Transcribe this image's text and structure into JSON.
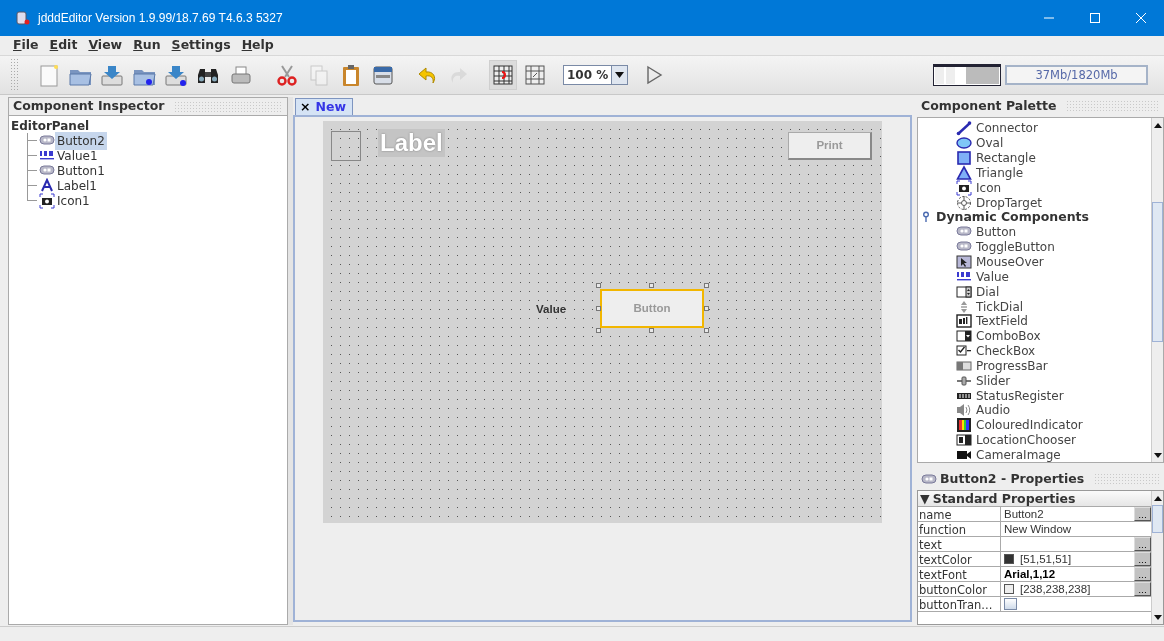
{
  "window": {
    "title": "jdddEditor Version 1.9.99/18.7.69 T4.6.3 5327"
  },
  "menu": [
    {
      "label": "File"
    },
    {
      "label": "Edit"
    },
    {
      "label": "View"
    },
    {
      "label": "Run"
    },
    {
      "label": "Settings"
    },
    {
      "label": "Help"
    }
  ],
  "toolbar": [
    {
      "kind": "new",
      "disabled": false,
      "selected": false
    },
    {
      "kind": "open",
      "disabled": false,
      "selected": false
    },
    {
      "kind": "import",
      "disabled": false,
      "selected": false
    },
    {
      "kind": "open-dot",
      "disabled": false,
      "selected": false
    },
    {
      "kind": "import-dot",
      "disabled": false,
      "selected": false
    },
    {
      "kind": "find",
      "disabled": false,
      "selected": false
    },
    {
      "kind": "print",
      "disabled": false,
      "selected": false
    },
    {
      "kind": "cut",
      "disabled": false,
      "selected": false
    },
    {
      "kind": "copy",
      "disabled": true,
      "selected": false
    },
    {
      "kind": "paste",
      "disabled": false,
      "selected": false
    },
    {
      "kind": "device",
      "disabled": false,
      "selected": false
    },
    {
      "kind": "undo",
      "disabled": false,
      "selected": false
    },
    {
      "kind": "redo",
      "disabled": true,
      "selected": false
    },
    {
      "kind": "grid",
      "disabled": false,
      "selected": true
    },
    {
      "kind": "snap",
      "disabled": false,
      "selected": false
    },
    {
      "kind": "zoom",
      "value": "100 %"
    },
    {
      "kind": "run",
      "disabled": false,
      "selected": false
    }
  ],
  "memory": "37Mb/1820Mb",
  "inspector": {
    "title": "Component Inspector",
    "tree": [
      {
        "label": "EditorPanel",
        "children": [
          {
            "label": "Button2",
            "kind": "button",
            "selected": true
          },
          {
            "label": "Value1",
            "kind": "value",
            "selected": false
          },
          {
            "label": "Button1",
            "kind": "button",
            "selected": false
          },
          {
            "label": "Label1",
            "kind": "label",
            "selected": false
          },
          {
            "label": "Icon1",
            "kind": "icon",
            "selected": false
          }
        ]
      }
    ]
  },
  "editor": {
    "tabs": [
      {
        "label": "New",
        "close": "×",
        "selected": true
      }
    ],
    "components": [
      {
        "kind": "icon"
      },
      {
        "kind": "label",
        "text": "Label"
      },
      {
        "kind": "button",
        "text": "Print",
        "selected": false
      },
      {
        "kind": "value",
        "text": "Value"
      },
      {
        "kind": "button",
        "text": "Button",
        "selected": true
      }
    ]
  },
  "palette": {
    "title": "Component Palette",
    "items": [
      {
        "label": "Connector",
        "kind": "connector"
      },
      {
        "label": "Oval",
        "kind": "oval"
      },
      {
        "label": "Rectangle",
        "kind": "rectangle"
      },
      {
        "label": "Triangle",
        "kind": "triangle"
      },
      {
        "label": "Icon",
        "kind": "icon"
      },
      {
        "label": "DropTarget",
        "kind": "droptarget"
      },
      {
        "label": "Dynamic Components",
        "kind": "group",
        "expanded": true,
        "children": [
          {
            "label": "Button",
            "kind": "button"
          },
          {
            "label": "ToggleButton",
            "kind": "button"
          },
          {
            "label": "MouseOver",
            "kind": "mouseover"
          },
          {
            "label": "Value",
            "kind": "value"
          },
          {
            "label": "Dial",
            "kind": "dial"
          },
          {
            "label": "TickDial",
            "kind": "tickdial"
          },
          {
            "label": "TextField",
            "kind": "textfield"
          },
          {
            "label": "ComboBox",
            "kind": "combobox"
          },
          {
            "label": "CheckBox",
            "kind": "checkbox"
          },
          {
            "label": "ProgressBar",
            "kind": "progressbar"
          },
          {
            "label": "Slider",
            "kind": "slider"
          },
          {
            "label": "StatusRegister",
            "kind": "register"
          },
          {
            "label": "Audio",
            "kind": "audio"
          },
          {
            "label": "ColouredIndicator",
            "kind": "indicator"
          },
          {
            "label": "LocationChooser",
            "kind": "location"
          },
          {
            "label": "CameraImage",
            "kind": "camera"
          }
        ]
      }
    ]
  },
  "properties": {
    "title": "Button2 - Properties",
    "section": "Standard Properties",
    "section_toggle": "▼",
    "expanded": true,
    "rows": [
      {
        "name": "name",
        "value": "Button2",
        "kind": "text",
        "more": "..."
      },
      {
        "name": "function",
        "value": "New Window",
        "kind": "text"
      },
      {
        "name": "text",
        "kind": "text",
        "more": "..."
      },
      {
        "name": "textColor",
        "value": "[51,51,51]",
        "kind": "color",
        "color": "#333333",
        "more": "..."
      },
      {
        "name": "textFont",
        "value": "Arial,1,12",
        "kind": "font",
        "more": "..."
      },
      {
        "name": "buttonColor",
        "value": "[238,238,238]",
        "kind": "color",
        "color": "#eeeeee",
        "more": "..."
      },
      {
        "name": "buttonTran...",
        "kind": "checkbox",
        "checked": false
      }
    ]
  }
}
